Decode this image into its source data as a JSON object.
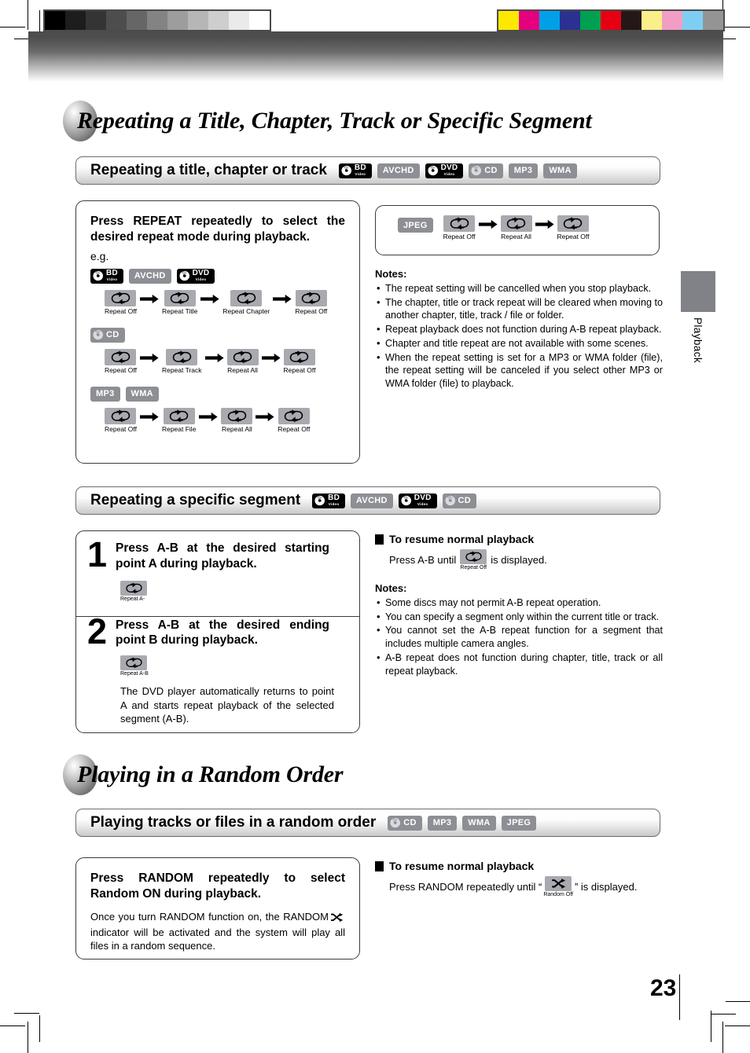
{
  "page": {
    "number": "23",
    "side_tab_label": "Playback"
  },
  "calibration": {
    "grayscale": [
      "#000000",
      "#1d1d1d",
      "#343434",
      "#4d4d4d",
      "#666666",
      "#838383",
      "#9d9d9d",
      "#b6b6b6",
      "#cecece",
      "#eaeaea",
      "#ffffff"
    ],
    "colors": [
      "#ffe800",
      "#e4007f",
      "#00a0e9",
      "#2b3190",
      "#00a051",
      "#e60012",
      "#231815",
      "#fbef8a",
      "#f29ec4",
      "#7ecef4",
      "#949495"
    ]
  },
  "chapters": [
    {
      "title": "Repeating a Title, Chapter, Track or Specific Segment"
    },
    {
      "title": "Playing in a Random Order"
    }
  ],
  "sections": {
    "repeat_title": {
      "heading": "Repeating a title, chapter or track",
      "badges": [
        {
          "type": "dark-disc",
          "line1": "BD",
          "line2": "Video"
        },
        {
          "type": "plain",
          "label": "AVCHD"
        },
        {
          "type": "dark-disc",
          "line1": "DVD",
          "line2": "Video"
        },
        {
          "type": "gray-disc",
          "label": "CD"
        },
        {
          "type": "plain",
          "label": "MP3"
        },
        {
          "type": "plain",
          "label": "WMA"
        }
      ],
      "instruction": "Press REPEAT repeatedly to select the desired repeat mode during playback.",
      "eg_label": "e.g.",
      "flows": [
        {
          "badges": [
            {
              "type": "dark-disc",
              "line1": "BD",
              "line2": "Video"
            },
            {
              "type": "plain",
              "label": "AVCHD"
            },
            {
              "type": "dark-disc",
              "line1": "DVD",
              "line2": "Video"
            }
          ],
          "steps": [
            "Repeat Off",
            "Repeat Title",
            "Repeat Chapter",
            "Repeat Off"
          ]
        },
        {
          "badges": [
            {
              "type": "gray-disc",
              "label": "CD"
            }
          ],
          "steps": [
            "Repeat Off",
            "Repeat Track",
            "Repeat All",
            "Repeat Off"
          ]
        },
        {
          "badges": [
            {
              "type": "plain",
              "label": "MP3"
            },
            {
              "type": "plain",
              "label": "WMA"
            }
          ],
          "steps": [
            "Repeat Off",
            "Repeat File",
            "Repeat All",
            "Repeat Off"
          ]
        }
      ],
      "jpeg_flow": {
        "badges": [
          {
            "type": "plain",
            "label": "JPEG"
          }
        ],
        "steps": [
          "Repeat Off",
          "Repeat All",
          "Repeat Off"
        ]
      },
      "notes_heading": "Notes:",
      "notes": [
        "The repeat setting will be cancelled when you stop playback.",
        "The chapter, title or track repeat will be cleared when moving to another chapter, title, track / file or folder.",
        "Repeat playback does not function during A-B repeat playback.",
        "Chapter and title repeat are not available with some scenes.",
        "When the repeat setting is set for a MP3 or WMA folder (file), the repeat setting will be canceled if you select other MP3 or WMA folder (file) to playback."
      ]
    },
    "repeat_segment": {
      "heading": "Repeating a specific segment",
      "badges": [
        {
          "type": "dark-disc",
          "line1": "BD",
          "line2": "Video"
        },
        {
          "type": "plain",
          "label": "AVCHD"
        },
        {
          "type": "dark-disc",
          "line1": "DVD",
          "line2": "Video"
        },
        {
          "type": "gray-disc",
          "label": "CD"
        }
      ],
      "steps": [
        {
          "number": "1",
          "text": "Press A-B at the desired starting point A during playback.",
          "chip_label": "Repeat A-"
        },
        {
          "number": "2",
          "text": "Press A-B at the desired ending point B during playback.",
          "chip_label": "Repeat A-B",
          "body": "The DVD player automatically returns to point A and starts repeat playback of the selected segment (A-B)."
        }
      ],
      "resume_heading": "To resume normal playback",
      "resume_prefix": "Press A-B until",
      "resume_chip_label": "Repeat Off",
      "resume_suffix": "is displayed.",
      "notes_heading": "Notes:",
      "notes": [
        "Some discs may not permit A-B repeat operation.",
        "You can specify a segment only within the current title or track.",
        "You cannot set the A-B repeat function for a segment that includes multiple camera angles.",
        "A-B repeat does not function during chapter, title, track or all repeat playback."
      ]
    },
    "random": {
      "heading": "Playing tracks or files in a random order",
      "badges": [
        {
          "type": "gray-disc",
          "label": "CD"
        },
        {
          "type": "plain",
          "label": "MP3"
        },
        {
          "type": "plain",
          "label": "WMA"
        },
        {
          "type": "plain",
          "label": "JPEG"
        }
      ],
      "instruction": "Press RANDOM repeatedly to select Random ON during playback.",
      "body_pre": "Once you turn RANDOM function on, the RANDOM",
      "body_post": "indicator will be activated and the system will play all files in a random sequence.",
      "resume_heading": "To resume normal playback",
      "resume_prefix": "Press RANDOM repeatedly until “",
      "resume_chip_label": "Random Off",
      "resume_suffix": "” is displayed."
    }
  },
  "icons": {
    "repeat": "repeat-loop-icon",
    "random": "shuffle-icon",
    "arrow": "arrow-right-icon",
    "disc": "disc-icon"
  }
}
